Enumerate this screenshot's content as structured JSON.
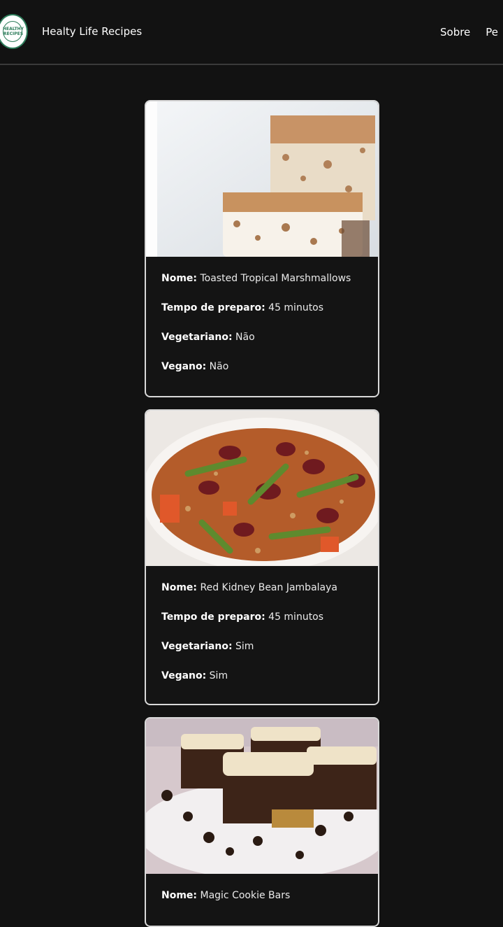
{
  "header": {
    "logo_text": "HEALTHY RECIPES",
    "brand": "Healty Life Recipes",
    "nav": [
      "Sobre",
      "Pe"
    ]
  },
  "labels": {
    "name": "Nome:",
    "prep": "Tempo de preparo:",
    "vegetarian": "Vegetariano:",
    "vegan": "Vegano:"
  },
  "recipes": [
    {
      "name": "Toasted Tropical Marshmallows",
      "prep_time": "45 minutos",
      "vegetarian": "Não",
      "vegan": "Não",
      "image": "coconut-marshmallow-squares"
    },
    {
      "name": "Red Kidney Bean Jambalaya",
      "prep_time": "45 minutos",
      "vegetarian": "Sim",
      "vegan": "Sim",
      "image": "bean-jambalaya-bowl"
    },
    {
      "name": "Magic Cookie Bars",
      "image": "chocolate-coconut-bars"
    }
  ]
}
